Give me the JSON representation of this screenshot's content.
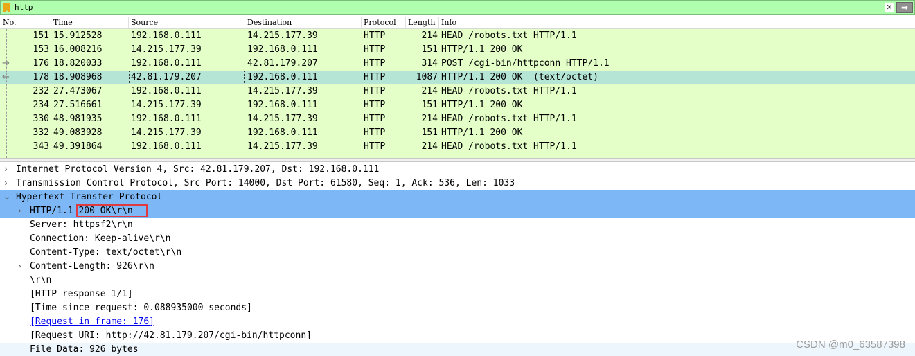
{
  "filter": {
    "text": "http",
    "clear_icon": "clear-icon",
    "apply_icon": "arrow-right-icon"
  },
  "columns": {
    "no": "No.",
    "time": "Time",
    "source": "Source",
    "destination": "Destination",
    "protocol": "Protocol",
    "length": "Length",
    "info": "Info"
  },
  "packets": [
    {
      "no": "151",
      "time": "15.912528",
      "source": "192.168.0.111",
      "destination": "14.215.177.39",
      "protocol": "HTTP",
      "length": "214",
      "info": "HEAD /robots.txt HTTP/1.1"
    },
    {
      "no": "153",
      "time": "16.008216",
      "source": "14.215.177.39",
      "destination": "192.168.0.111",
      "protocol": "HTTP",
      "length": "151",
      "info": "HTTP/1.1 200 OK"
    },
    {
      "no": "176",
      "time": "18.820033",
      "source": "192.168.0.111",
      "destination": "42.81.179.207",
      "protocol": "HTTP",
      "length": "314",
      "info": "POST /cgi-bin/httpconn HTTP/1.1"
    },
    {
      "no": "178",
      "time": "18.908968",
      "source": "42.81.179.207",
      "destination": "192.168.0.111",
      "protocol": "HTTP",
      "length": "1087",
      "info": "HTTP/1.1 200 OK  (text/octet)"
    },
    {
      "no": "232",
      "time": "27.473067",
      "source": "192.168.0.111",
      "destination": "14.215.177.39",
      "protocol": "HTTP",
      "length": "214",
      "info": "HEAD /robots.txt HTTP/1.1"
    },
    {
      "no": "234",
      "time": "27.516661",
      "source": "14.215.177.39",
      "destination": "192.168.0.111",
      "protocol": "HTTP",
      "length": "151",
      "info": "HTTP/1.1 200 OK"
    },
    {
      "no": "330",
      "time": "48.981935",
      "source": "192.168.0.111",
      "destination": "14.215.177.39",
      "protocol": "HTTP",
      "length": "214",
      "info": "HEAD /robots.txt HTTP/1.1"
    },
    {
      "no": "332",
      "time": "49.083928",
      "source": "14.215.177.39",
      "destination": "192.168.0.111",
      "protocol": "HTTP",
      "length": "151",
      "info": "HTTP/1.1 200 OK"
    },
    {
      "no": "343",
      "time": "49.391864",
      "source": "192.168.0.111",
      "destination": "14.215.177.39",
      "protocol": "HTTP",
      "length": "214",
      "info": "HEAD /robots.txt HTTP/1.1"
    }
  ],
  "details": {
    "ip": "Internet Protocol Version 4, Src: 42.81.179.207, Dst: 192.168.0.111",
    "tcp": "Transmission Control Protocol, Src Port: 14000, Dst Port: 61580, Seq: 1, Ack: 536, Len: 1033",
    "http": "Hypertext Transfer Protocol",
    "status_line": "HTTP/1.1 200 OK\\r\\n",
    "server": "Server: httpsf2\\r\\n",
    "connection": "Connection: Keep-alive\\r\\n",
    "content_type": "Content-Type: text/octet\\r\\n",
    "content_length": "Content-Length: 926\\r\\n",
    "crlf": "\\r\\n",
    "response": "[HTTP response 1/1]",
    "time_since": "[Time since request: 0.088935000 seconds]",
    "request_frame": "[Request in frame: 176]",
    "request_uri": "[Request URI: http://42.81.179.207/cgi-bin/httpconn]",
    "file_data": "File Data: 926 bytes"
  },
  "watermark": "CSDN @m0_63587398",
  "colors": {
    "filter_bg": "#afffaf",
    "row_bg": "#e4ffc7",
    "selected_row": "#b5e5d4",
    "tree_highlight": "#7eb7f5",
    "annotation_box": "#e0393e"
  }
}
